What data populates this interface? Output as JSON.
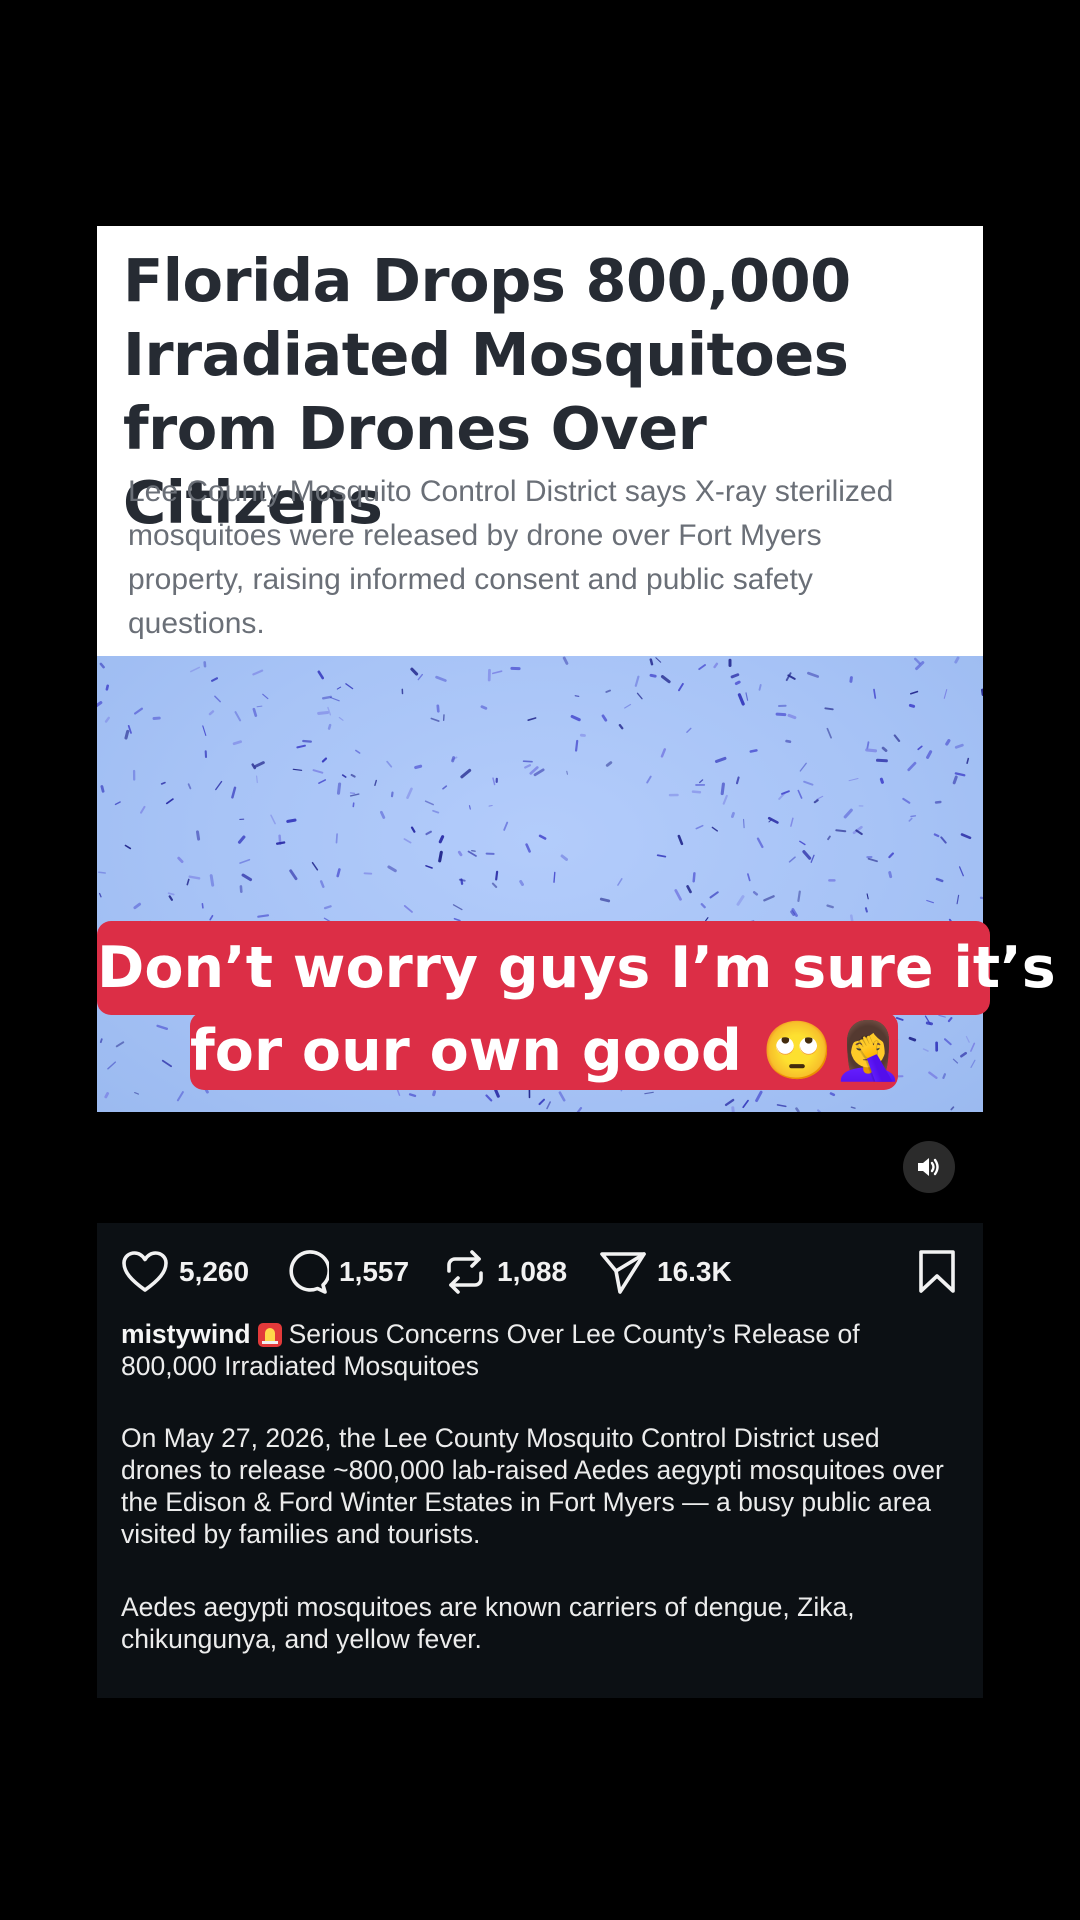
{
  "article": {
    "headline": "Florida Drops 800,000 Irradiated Mosquitoes from Drones Over Citizens",
    "subheadline": "Lee County Mosquito Control District says X-ray sterilized mosquitoes were released by drone over Fort Myers property, raising informed consent and public safety questions."
  },
  "overlay_caption": {
    "line1": "Don’t worry guys I’m sure it’s",
    "line2": "for our own good 🙄🤦‍♀️"
  },
  "actions": {
    "likes": "5,260",
    "comments": "1,557",
    "reposts": "1,088",
    "shares": "16.3K"
  },
  "post": {
    "username": "mistywind",
    "title": "Serious Concerns Over Lee County’s Release of 800,000 Irradiated Mosquitoes",
    "paragraph1": "On May 27, 2026, the Lee County Mosquito Control District used drones to release ~800,000 lab-raised Aedes aegypti mosquitoes over the Edison & Ford Winter Estates in Fort Myers — a busy public area visited by families and tourists.",
    "paragraph2": "Aedes aegypti mosquitoes are known carriers of dengue, Zika, chikungunya, and yellow fever."
  },
  "icons": {
    "like": "heart-icon",
    "comment": "comment-bubble-icon",
    "repost": "repost-icon",
    "share": "send-icon",
    "save": "bookmark-icon",
    "sound": "speaker-icon",
    "alarm": "rotating-light-icon"
  },
  "colors": {
    "caption_background": "#dc2e46",
    "panel_background": "#0c1014",
    "photo_sky": "#a7c3f6"
  }
}
